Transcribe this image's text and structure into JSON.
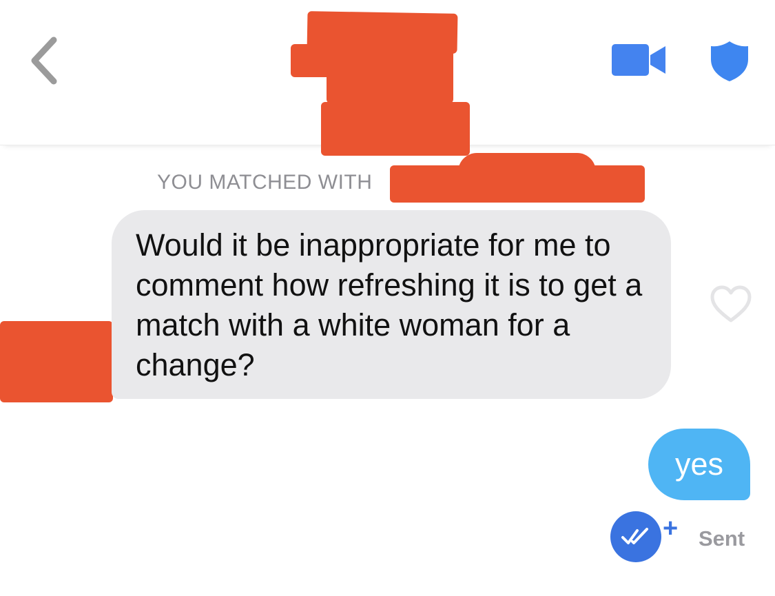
{
  "header": {
    "back_icon": "chevron-left-icon",
    "video_icon": "video-camera-icon",
    "safety_icon": "shield-icon"
  },
  "match_banner": {
    "label": "YOU MATCHED WITH"
  },
  "messages": [
    {
      "direction": "incoming",
      "text": "Would it be inappropriate for me to comment how refreshing it is to get a match with a white woman for a change?"
    },
    {
      "direction": "outgoing",
      "text": "yes",
      "status": "Sent"
    }
  ],
  "colors": {
    "accent_blue": "#3a73e0",
    "outgoing_bubble": "#4fb5f4",
    "incoming_bubble": "#e9e9eb",
    "redaction": "#ea5430",
    "muted_text": "#8e8e93"
  }
}
